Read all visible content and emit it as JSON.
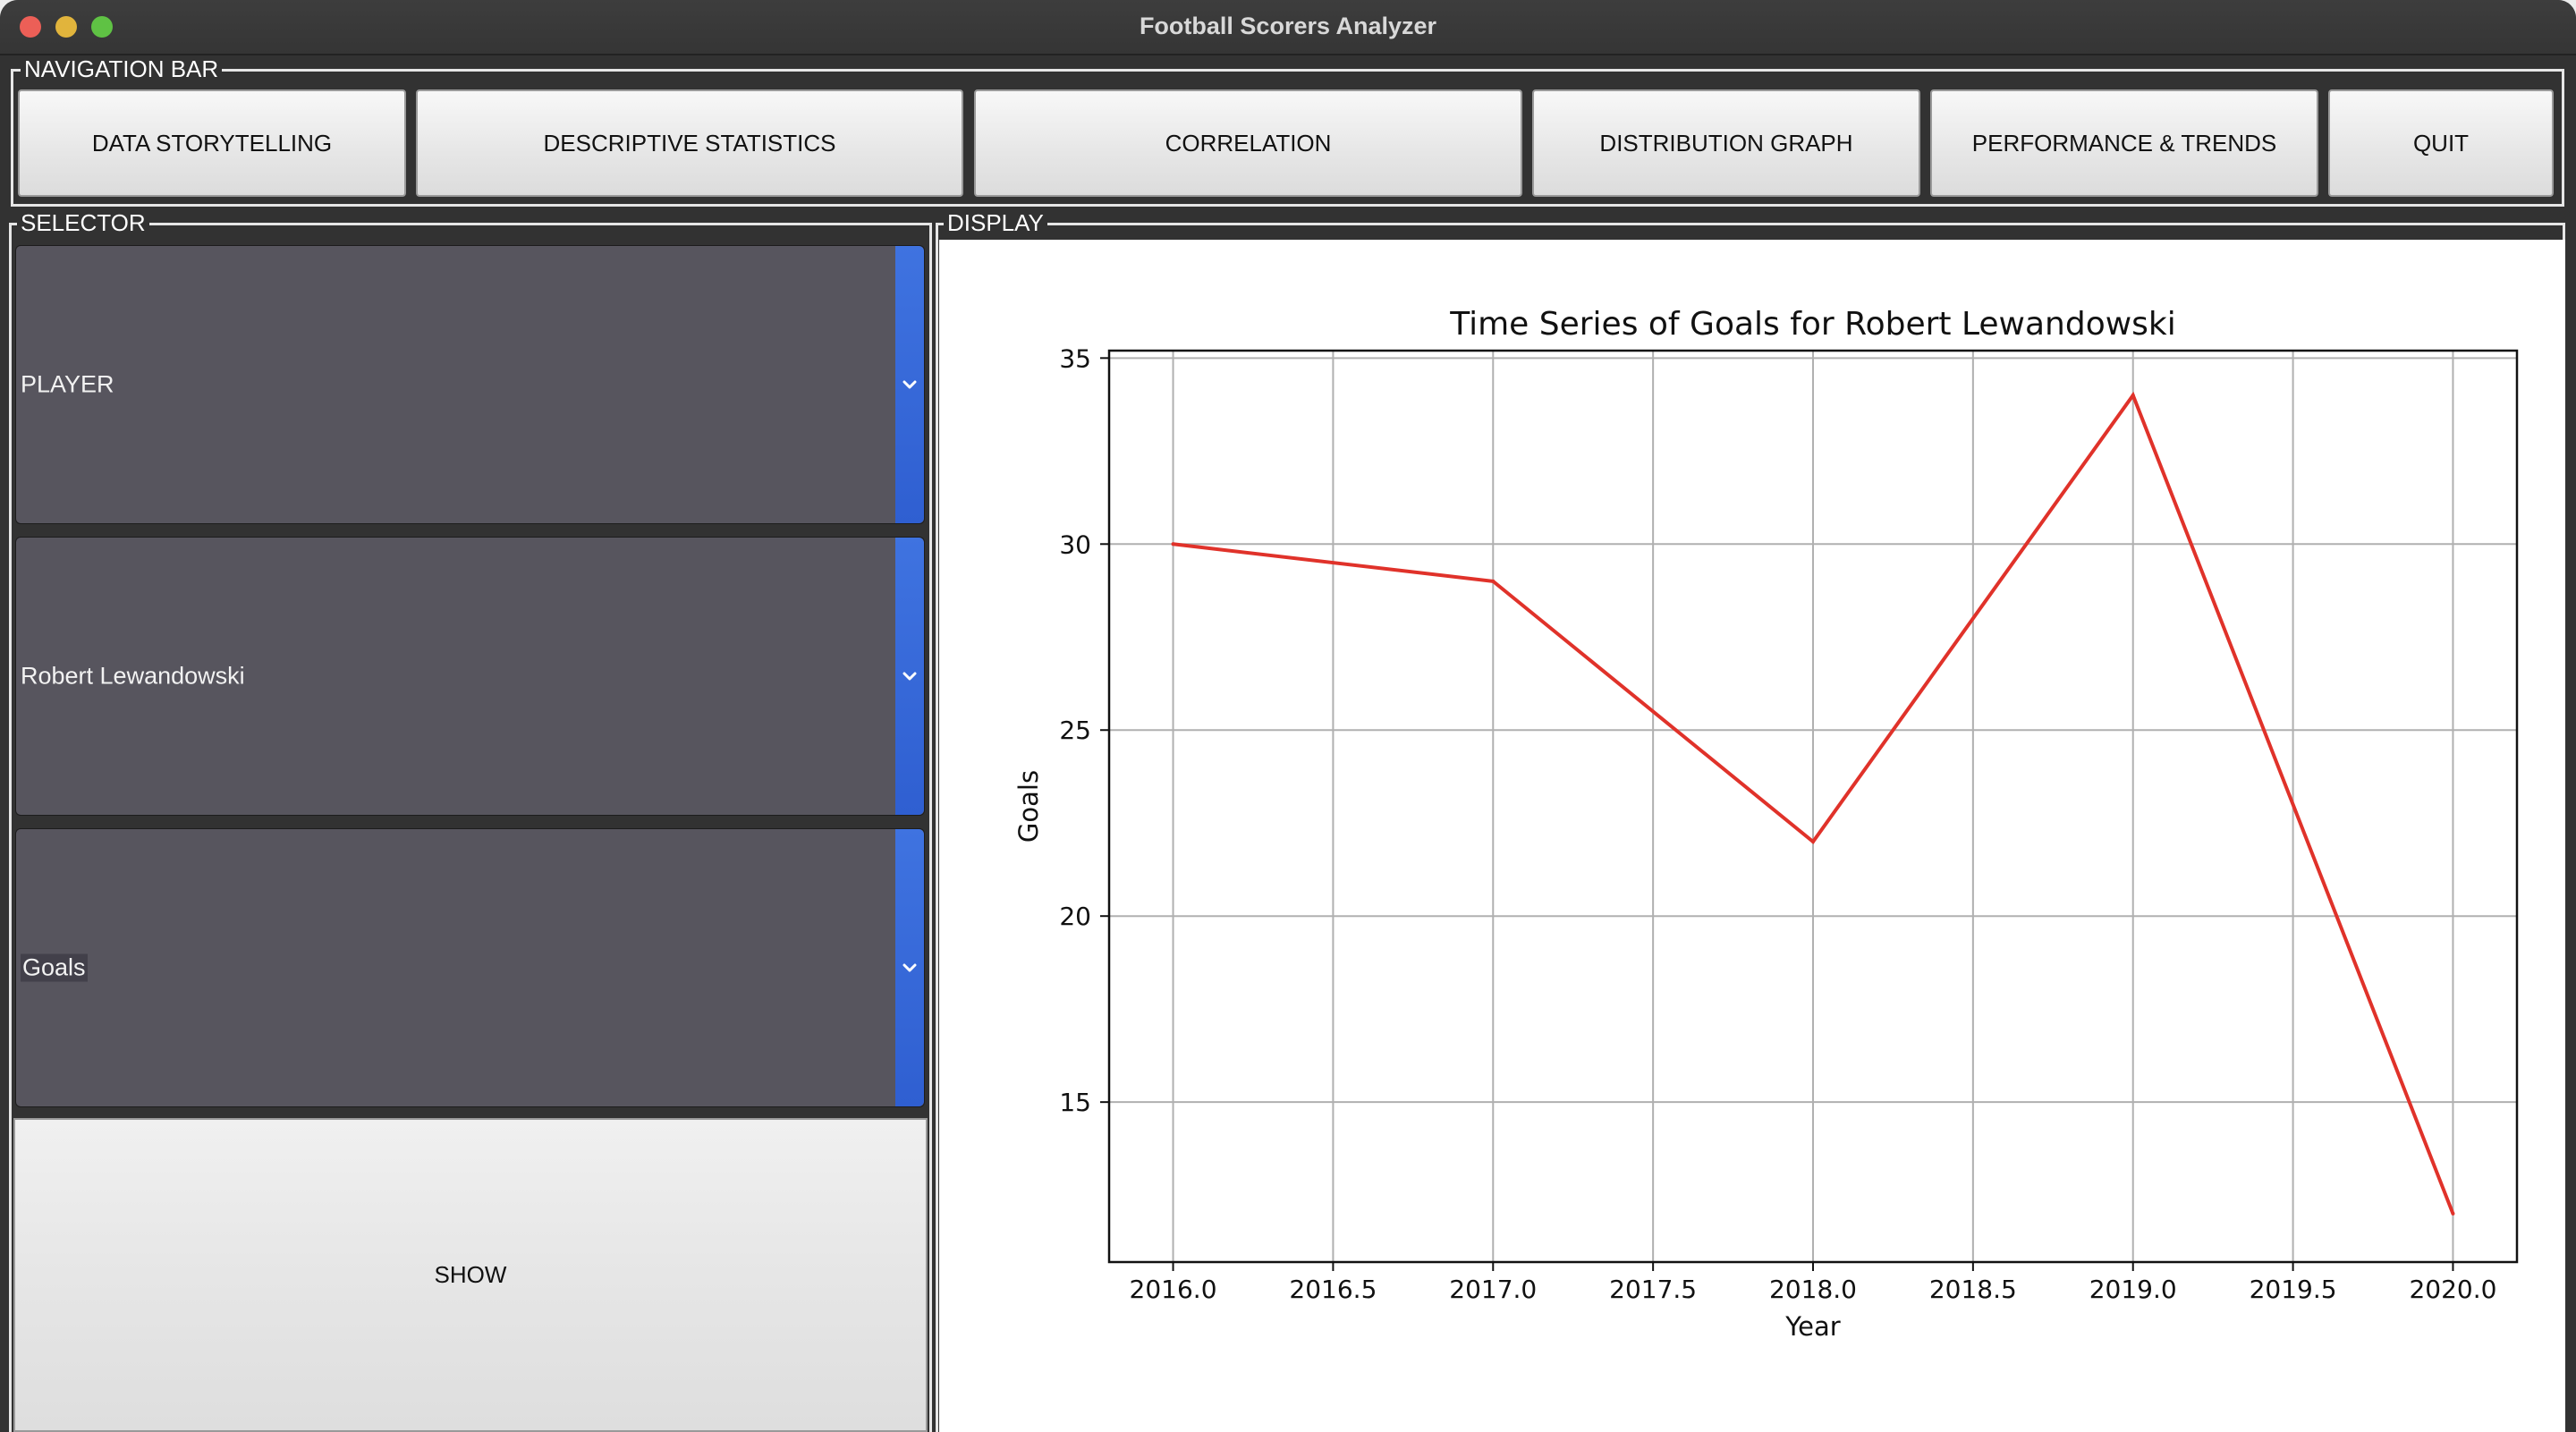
{
  "window": {
    "title": "Football Scorers Analyzer"
  },
  "nav": {
    "frame_label": "NAVIGATION BAR",
    "buttons": [
      "DATA STORYTELLING",
      "DESCRIPTIVE STATISTICS",
      "CORRELATION",
      "DISTRIBUTION GRAPH",
      "PERFORMANCE & TRENDS",
      "QUIT"
    ]
  },
  "selector": {
    "frame_label": "SELECTOR",
    "category_value": "PLAYER",
    "player_value": "Robert Lewandowski",
    "metric_value": "Goals",
    "show_label": "SHOW"
  },
  "display": {
    "frame_label": "DISPLAY"
  },
  "chart_data": {
    "type": "line",
    "title": "Time Series of Goals for Robert Lewandowski",
    "xlabel": "Year",
    "ylabel": "Goals",
    "x": [
      2016,
      2017,
      2018,
      2019,
      2020
    ],
    "series": [
      {
        "values": [
          30,
          29,
          22,
          34,
          12
        ],
        "color": "#e0322a"
      }
    ],
    "xlim": [
      2015.8,
      2020.2
    ],
    "ylim": [
      10.7,
      35.2
    ],
    "xticks": [
      "2016.0",
      "2016.5",
      "2017.0",
      "2017.5",
      "2018.0",
      "2018.5",
      "2019.0",
      "2019.5",
      "2020.0"
    ],
    "yticks": [
      "15",
      "20",
      "25",
      "30",
      "35"
    ],
    "grid": true
  }
}
